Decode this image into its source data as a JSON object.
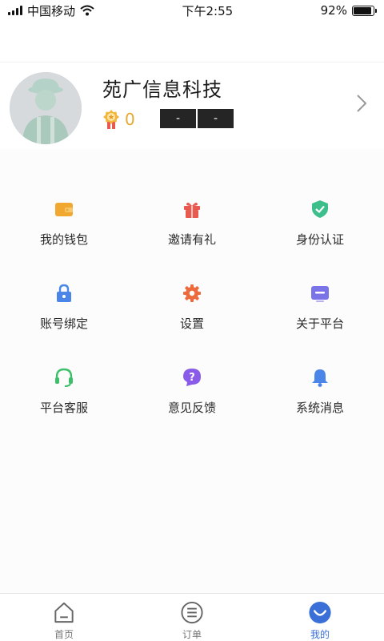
{
  "status_bar": {
    "carrier": "中国移动",
    "time": "下午2:55",
    "battery": "92%",
    "battery_level": 0.92
  },
  "profile": {
    "name": "苑广信息科技",
    "points": "0",
    "masked_left": "-",
    "masked_right": "-",
    "avatar_icon": "worker-avatar-icon",
    "medal_icon": "medal-icon",
    "arrow_icon": "chevron-right-icon"
  },
  "menu": [
    [
      {
        "label": "我的钱包",
        "icon": "wallet-icon",
        "color": "#f0a830"
      },
      {
        "label": "邀请有礼",
        "icon": "gift-icon",
        "color": "#e85a4f"
      },
      {
        "label": "身份认证",
        "icon": "shield-check-icon",
        "color": "#3dbf8c"
      }
    ],
    [
      {
        "label": "账号绑定",
        "icon": "lock-icon",
        "color": "#4a86e8"
      },
      {
        "label": "设置",
        "icon": "gear-icon",
        "color": "#ee6a3c"
      },
      {
        "label": "关于平台",
        "icon": "info-card-icon",
        "color": "#7a74e8"
      }
    ],
    [
      {
        "label": "平台客服",
        "icon": "headset-icon",
        "color": "#3dbf6a"
      },
      {
        "label": "意见反馈",
        "icon": "feedback-question-icon",
        "color": "#8a5ae8"
      },
      {
        "label": "系统消息",
        "icon": "bell-icon",
        "color": "#4a86e8"
      }
    ]
  ],
  "tabs": [
    {
      "label": "首页",
      "icon": "home-icon",
      "active": false
    },
    {
      "label": "订单",
      "icon": "order-list-icon",
      "active": false
    },
    {
      "label": "我的",
      "icon": "profile-icon",
      "active": true
    }
  ],
  "colors": {
    "accent": "#3a6fd8",
    "points": "#e8a830"
  }
}
